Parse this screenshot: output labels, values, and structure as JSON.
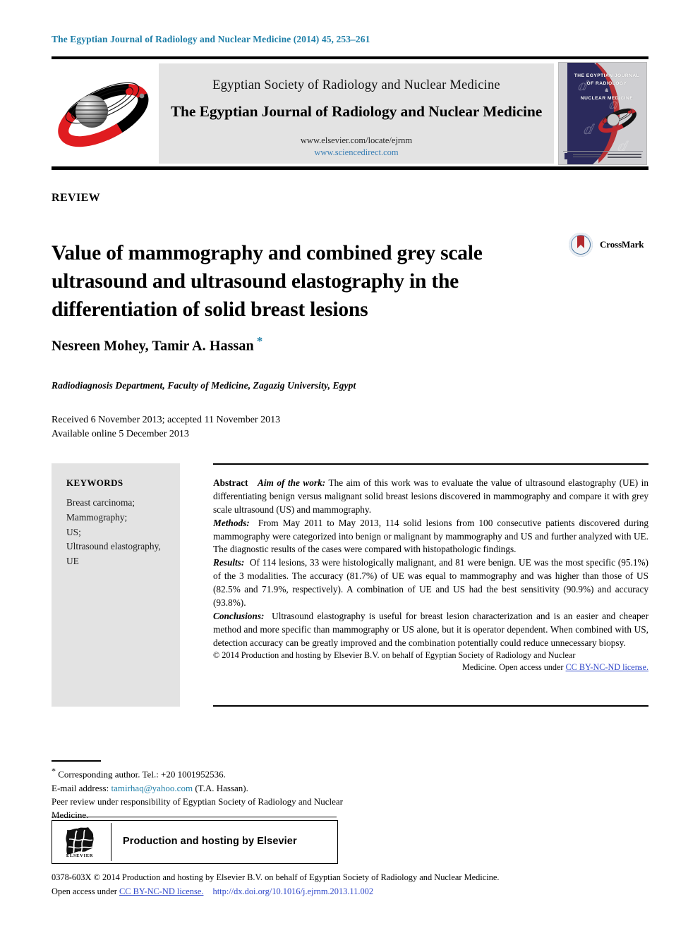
{
  "running_head": "The Egyptian Journal of Radiology and Nuclear Medicine (2014) 45, 253–261",
  "masthead": {
    "society_name": "Egyptian Society of Radiology and Nuclear Medicine",
    "journal_name": "The Egyptian Journal of Radiology and Nuclear Medicine",
    "elsevier_url": "www.elsevier.com/locate/ejrnm",
    "sciencedirect_url": "www.sciencedirect.com",
    "society_logo_icon": "atom-orbit-logo-icon",
    "cover_title_line1": "THE EGYPTIAN JOURNAL",
    "cover_title_line2": "OF RADIOLOGY",
    "cover_title_line3": "&",
    "cover_title_line4": "NUCLEAR MEDICINE"
  },
  "article": {
    "type": "REVIEW",
    "title": "Value of mammography and combined grey scale ultrasound and ultrasound elastography in the differentiation of solid breast lesions",
    "authors": "Nesreen Mohey, Tamir A. Hassan",
    "corresponding_marker": "*",
    "affiliation": "Radiodiagnosis Department, Faculty of Medicine, Zagazig University, Egypt",
    "history_received": "Received 6 November 2013; accepted 11 November 2013",
    "history_available": "Available online 5 December 2013"
  },
  "crossmark": {
    "label": "CrossMark",
    "icon": "crossmark-icon"
  },
  "keywords": {
    "title": "KEYWORDS",
    "items": [
      "Breast carcinoma;",
      "Mammography;",
      "US;",
      "Ultrasound elastography,",
      "UE"
    ]
  },
  "abstract": {
    "heading": "Abstract",
    "aim_label": "Aim of the work:",
    "aim_text": "The aim of this work was to evaluate the value of ultrasound elastography (UE) in differentiating benign versus malignant solid breast lesions discovered in mammography and compare it with grey scale ultrasound (US) and mammography.",
    "methods_label": "Methods:",
    "methods_text": "From May 2011 to May 2013, 114 solid lesions from 100 consecutive patients discovered during mammography were categorized into benign or malignant by mammography and US and further analyzed with UE. The diagnostic results of the cases were compared with histopathologic findings.",
    "results_label": "Results:",
    "results_text": "Of 114 lesions, 33 were histologically malignant, and 81 were benign. UE was the most specific (95.1%) of the 3 modalities. The accuracy (81.7%) of UE was equal to mammography and was higher than those of US (82.5% and 71.9%, respectively). A combination of UE and US had the best sensitivity (90.9%) and accuracy (93.8%).",
    "conclusions_label": "Conclusions:",
    "conclusions_text": "Ultrasound elastography is useful for breast lesion characterization and is an easier and cheaper method and more specific than mammography or US alone, but it is operator dependent. When combined with US, detection accuracy can be greatly improved and the combination potentially could reduce unnecessary biopsy.",
    "copyright_main": "© 2014 Production and hosting by Elsevier B.V. on behalf of Egyptian Society of Radiology and Nuclear",
    "copyright_tail_plain": "Medicine. Open access under",
    "copyright_tail_link": "CC BY-NC-ND license."
  },
  "footnotes": {
    "corresponding_marker": "*",
    "corresponding": "Corresponding author. Tel.: +20 1001952536.",
    "email_label": "E-mail address:",
    "email_link": "tamirhaq@yahoo.com",
    "email_suffix": "(T.A. Hassan).",
    "peer_review": "Peer review under responsibility of Egyptian Society of Radiology and Nuclear Medicine."
  },
  "elsevier_box": {
    "text": "Production and hosting by Elsevier",
    "wordmark": "ELSEVIER",
    "logo_icon": "elsevier-tree-icon"
  },
  "bottom": {
    "line1": "0378-603X © 2014 Production and hosting by Elsevier B.V. on behalf of Egyptian Society of Radiology and Nuclear Medicine.",
    "line2_plain_prefix": "Open access under",
    "line2_license_link": "CC BY-NC-ND license.",
    "doi": "http://dx.doi.org/10.1016/j.ejrnm.2013.11.002"
  },
  "colors": {
    "running_head_blue": "#1f7fa8",
    "link_blue": "#2f47c9",
    "banner_grey": "#e3e3e3",
    "keywords_grey": "#e3e3e3",
    "cover_navy": "#2b2a5c",
    "cover_red": "#b21f24"
  }
}
